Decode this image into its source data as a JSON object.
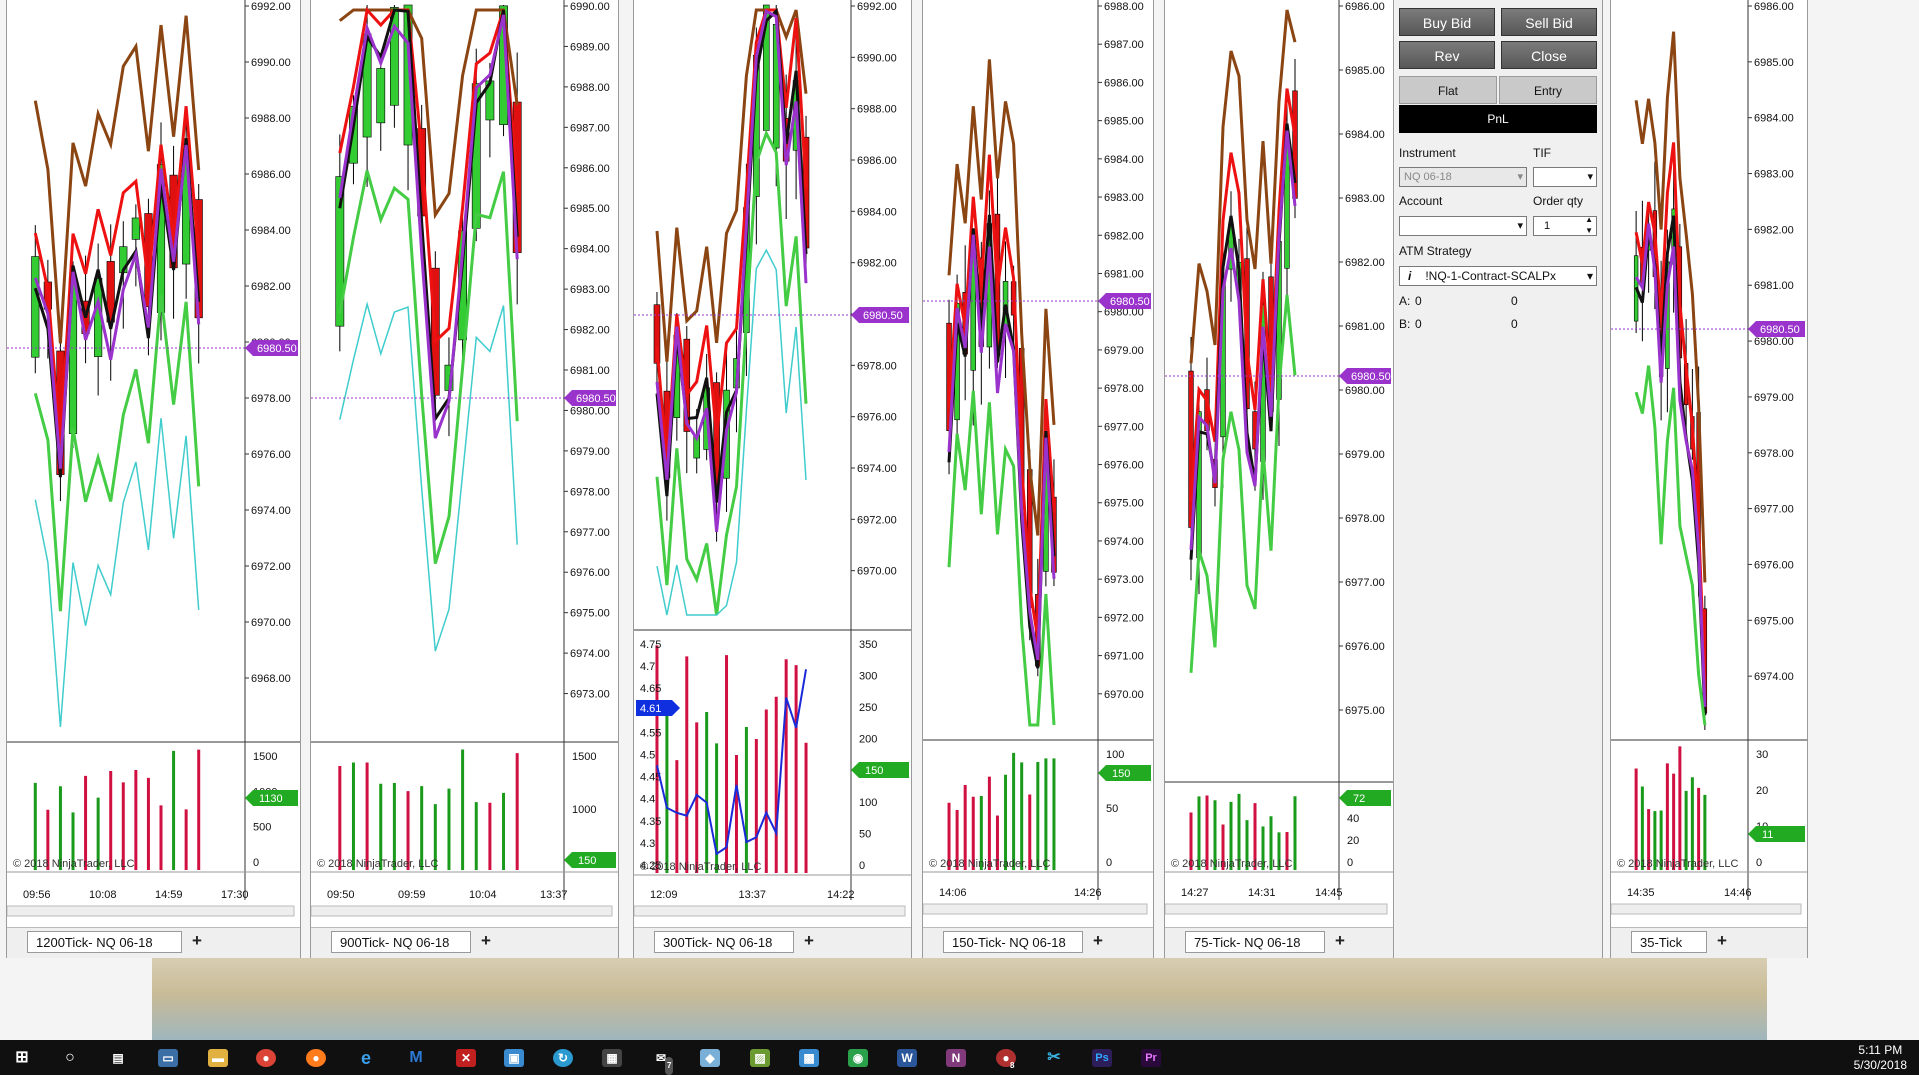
{
  "charts": [
    {
      "id": "c1",
      "tab": "1200Tick- NQ 06-18",
      "price_labels": [
        "6992.00",
        "6990.00",
        "6988.00",
        "6986.00",
        "6984.00",
        "6982.00",
        "6980.00",
        "6978.00",
        "6976.00",
        "6974.00",
        "6972.00",
        "6970.00",
        "6968.00"
      ],
      "price_tag": "6980.50",
      "volume_labels": [
        "1500",
        "1000",
        "500",
        "0"
      ],
      "volume_tag": "1130",
      "time_labels": [
        "09:56",
        "10:08",
        "14:59",
        "17:30"
      ],
      "copyright": "© 2018 NinjaTrader, LLC"
    },
    {
      "id": "c2",
      "tab": "900Tick- NQ 06-18",
      "price_labels": [
        "6990.00",
        "6989.00",
        "6988.00",
        "6987.00",
        "6986.00",
        "6985.00",
        "6984.00",
        "6983.00",
        "6982.00",
        "6981.00",
        "6980.00",
        "6979.00",
        "6978.00",
        "6977.00",
        "6976.00",
        "6975.00",
        "6974.00",
        "6973.00"
      ],
      "price_tag": "6980.50",
      "volume_labels": [
        "1500",
        "1000",
        "500"
      ],
      "volume_tag": "150",
      "time_labels": [
        "09:50",
        "09:59",
        "10:04",
        "13:37"
      ],
      "copyright": "© 2018 NinjaTrader, LLC"
    },
    {
      "id": "c3",
      "tab": "300Tick- NQ 06-18",
      "price_labels": [
        "6992.00",
        "6990.00",
        "6988.00",
        "6986.00",
        "6984.00",
        "6982.00",
        "6980.00",
        "6978.00",
        "6976.00",
        "6974.00",
        "6972.00",
        "6970.00"
      ],
      "price_tag": "6980.50",
      "volume_labels": [
        "350",
        "300",
        "250",
        "200",
        "150",
        "100",
        "50",
        "0"
      ],
      "volume_tag": "150",
      "indicator_labels": [
        "4.75",
        "4.7",
        "4.65",
        "4.6",
        "4.55",
        "4.5",
        "4.45",
        "4.4",
        "4.35",
        "4.3",
        "4.25"
      ],
      "indicator_tag": "4.61",
      "time_labels": [
        "12:09",
        "13:37",
        "14:22"
      ],
      "copyright": "© 2018 NinjaTrader, LLC"
    },
    {
      "id": "c4",
      "tab": "150-Tick- NQ 06-18",
      "price_labels": [
        "6988.00",
        "6987.00",
        "6986.00",
        "6985.00",
        "6984.00",
        "6983.00",
        "6982.00",
        "6981.00",
        "6980.00",
        "6979.00",
        "6978.00",
        "6977.00",
        "6976.00",
        "6975.00",
        "6974.00",
        "6973.00",
        "6972.00",
        "6971.00",
        "6970.00"
      ],
      "price_tag": "6980.50",
      "volume_labels": [
        "100",
        "50",
        "0"
      ],
      "volume_tag": "150",
      "time_labels": [
        "14:06",
        "14:26"
      ],
      "copyright": "© 2018 NinjaTrader, LLC"
    },
    {
      "id": "c5",
      "tab": "75-Tick- NQ 06-18",
      "price_labels": [
        "6986.00",
        "6985.00",
        "6984.00",
        "6983.00",
        "6982.00",
        "6981.00",
        "6980.00",
        "6979.00",
        "6978.00",
        "6977.00",
        "6976.00",
        "6975.00"
      ],
      "price_tag": "6980.50",
      "volume_labels": [
        "60",
        "40",
        "20",
        "0"
      ],
      "volume_tag": "72",
      "time_labels": [
        "14:27",
        "14:31",
        "14:45"
      ],
      "copyright": "© 2018 NinjaTrader, LLC"
    },
    {
      "id": "c6",
      "tab": "35-Tick",
      "price_labels": [
        "6986.00",
        "6985.00",
        "6984.00",
        "6983.00",
        "6982.00",
        "6981.00",
        "6980.00",
        "6979.00",
        "6978.00",
        "6977.00",
        "6976.00",
        "6975.00",
        "6974.00"
      ],
      "price_tag": "6980.50",
      "volume_labels": [
        "30",
        "20",
        "10",
        "0"
      ],
      "volume_tag": "11",
      "time_labels": [
        "14:35",
        "14:46"
      ],
      "copyright": "© 2018 NinjaTrader, LLC"
    }
  ],
  "order_panel": {
    "buy_bid": "Buy Bid",
    "sell_bid": "Sell Bid",
    "rev": "Rev",
    "close": "Close",
    "flat": "Flat",
    "entry": "Entry",
    "pnl": "PnL",
    "instrument_label": "Instrument",
    "instrument_value": "NQ 06-18",
    "tif_label": "TIF",
    "account_label": "Account",
    "order_qty_label": "Order qty",
    "order_qty_value": "1",
    "atm_label": "ATM Strategy",
    "atm_value": "!NQ-1-Contract-SCALPx",
    "a_label": "A:",
    "a_val1": "0",
    "a_val2": "0",
    "b_label": "B:",
    "b_val1": "0",
    "b_val2": "0"
  },
  "taskbar": {
    "time": "5:11 PM",
    "date": "5/30/2018",
    "badge_mail": "7",
    "badge_8": "8"
  },
  "colors": {
    "up": "#33cc33",
    "down": "#e01010",
    "sma_brown": "#8b4513",
    "sma_red": "#ee1111",
    "sma_black": "#111111",
    "sma_purple": "#9933cc",
    "sma_green": "#44cc44",
    "sma_cyan": "#40cccc",
    "tag_purple": "#9933cc",
    "tag_green": "#22aa22"
  }
}
